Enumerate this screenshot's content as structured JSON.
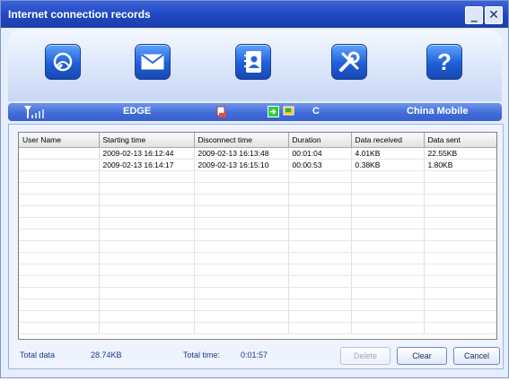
{
  "window": {
    "title": "Internet connection records",
    "minimize_glyph": "_",
    "close_glyph": "✕"
  },
  "toolbar": {
    "buttons": [
      {
        "icon": "globe-phone-icon"
      },
      {
        "icon": "envelope-icon"
      },
      {
        "icon": "address-book-icon"
      },
      {
        "icon": "tools-icon"
      },
      {
        "icon": "help-icon",
        "glyph": "?"
      }
    ]
  },
  "status": {
    "network": "EDGE",
    "connection_letter": "C",
    "carrier": "China Mobile"
  },
  "table": {
    "columns": [
      "User Name",
      "Starting time",
      "Disconnect time",
      "Duration",
      "Data received",
      "Data sent"
    ],
    "rows": [
      [
        "",
        "2009-02-13  16:12:44",
        "2009-02-13  16:13:48",
        "00:01:04",
        "4.01KB",
        "22.55KB"
      ],
      [
        "",
        "2009-02-13  16:14:17",
        "2009-02-13  16:15:10",
        "00:00:53",
        "0.38KB",
        "1.80KB"
      ]
    ]
  },
  "footer": {
    "total_data_label": "Total data",
    "total_data_value": "28.74KB",
    "total_time_label": "Total time:",
    "total_time_value": "0:01:57",
    "delete_label": "Delete",
    "clear_label": "Clear",
    "cancel_label": "Cancel"
  }
}
